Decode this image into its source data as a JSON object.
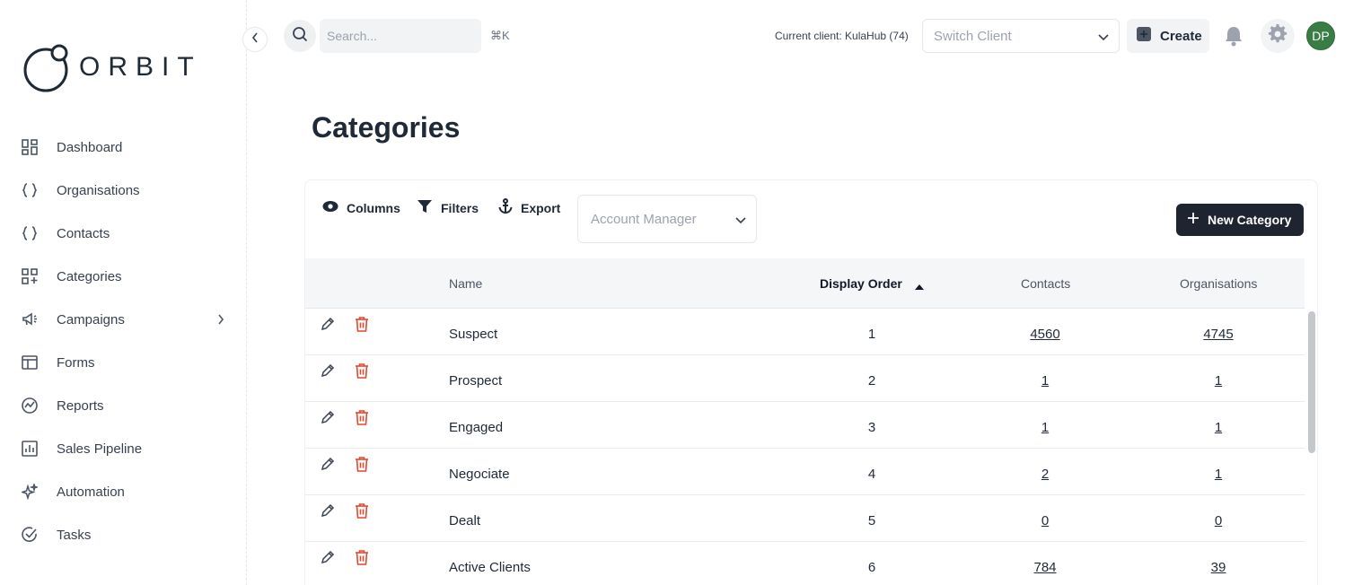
{
  "brand": {
    "name": "ORBIT"
  },
  "sidebar": {
    "items": [
      {
        "label": "Dashboard",
        "icon": "dashboard-icon"
      },
      {
        "label": "Organisations",
        "icon": "braces-icon"
      },
      {
        "label": "Contacts",
        "icon": "braces-icon"
      },
      {
        "label": "Categories",
        "icon": "grid-plus-icon"
      },
      {
        "label": "Campaigns",
        "icon": "megaphone-icon"
      },
      {
        "label": "Forms",
        "icon": "form-icon"
      },
      {
        "label": "Reports",
        "icon": "reports-icon"
      },
      {
        "label": "Sales Pipeline",
        "icon": "pipeline-icon"
      },
      {
        "label": "Automation",
        "icon": "sparkles-icon"
      },
      {
        "label": "Tasks",
        "icon": "task-check-icon"
      }
    ]
  },
  "topbar": {
    "search_placeholder": "Search...",
    "shortcut": "⌘K",
    "current_client": "Current client: KulaHub (74)",
    "switch_client_placeholder": "Switch Client",
    "create_label": "Create",
    "avatar_initials": "DP",
    "avatar_color": "#3a7d44"
  },
  "page": {
    "title": "Categories"
  },
  "toolbar": {
    "columns_label": "Columns",
    "filters_label": "Filters",
    "export_label": "Export",
    "account_manager_placeholder": "Account Manager",
    "new_category_label": "New Category"
  },
  "table": {
    "headers": {
      "name": "Name",
      "display_order": "Display Order",
      "contacts": "Contacts",
      "organisations": "Organisations"
    },
    "sorted_by": "Display Order",
    "sort_direction": "ascending",
    "rows": [
      {
        "name": "Suspect",
        "order": "1",
        "contacts": "4560",
        "organisations": "4745"
      },
      {
        "name": "Prospect",
        "order": "2",
        "contacts": "1",
        "organisations": "1"
      },
      {
        "name": "Engaged",
        "order": "3",
        "contacts": "1",
        "organisations": "1"
      },
      {
        "name": "Negociate",
        "order": "4",
        "contacts": "2",
        "organisations": "1"
      },
      {
        "name": "Dealt",
        "order": "5",
        "contacts": "0",
        "organisations": "0"
      },
      {
        "name": "Active Clients",
        "order": "6",
        "contacts": "784",
        "organisations": "39"
      }
    ]
  },
  "colors": {
    "accent_dark": "#1f2530",
    "delete_red": "#e0492f"
  }
}
